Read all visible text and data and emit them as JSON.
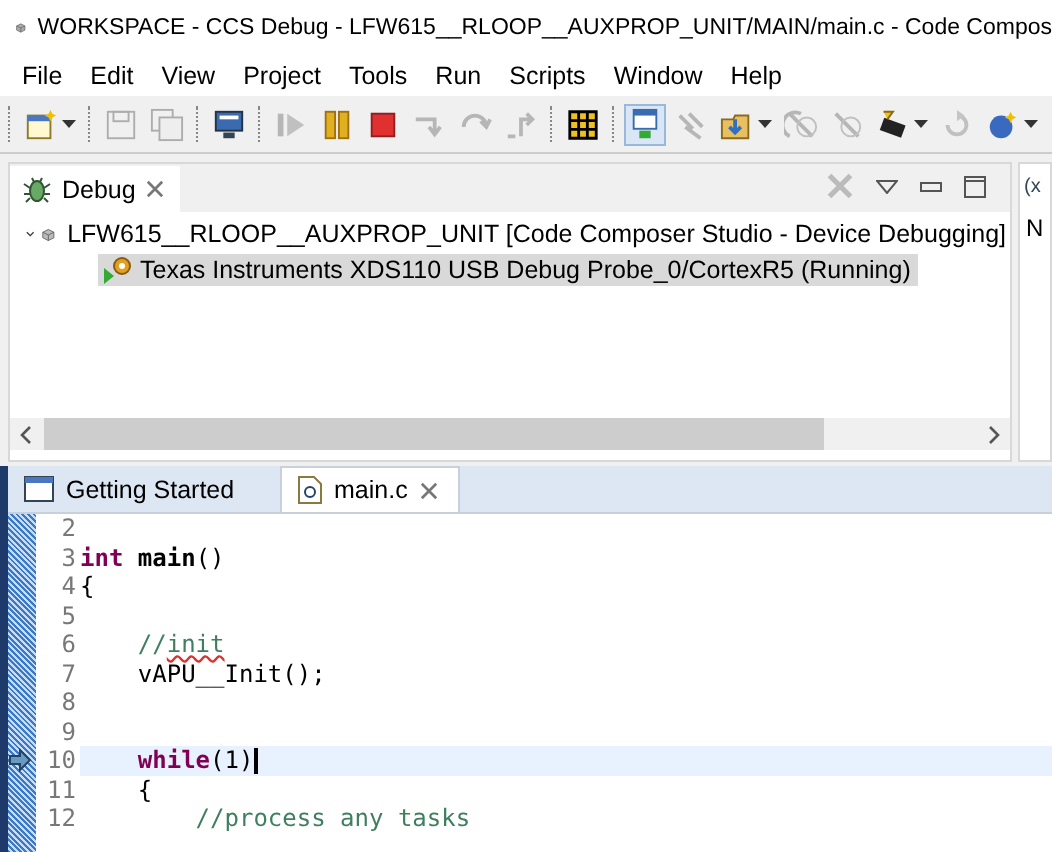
{
  "window": {
    "title": "WORKSPACE - CCS Debug - LFW615__RLOOP__AUXPROP_UNIT/MAIN/main.c - Code Compos"
  },
  "menu": [
    "File",
    "Edit",
    "View",
    "Project",
    "Tools",
    "Run",
    "Scripts",
    "Window",
    "Help"
  ],
  "toolbar": [
    [
      {
        "kind": "new",
        "disabled": false,
        "dropdown": true
      }
    ],
    [
      {
        "kind": "save",
        "disabled": true,
        "dropdown": false
      },
      {
        "kind": "save-all",
        "disabled": true,
        "dropdown": false
      }
    ],
    [
      {
        "kind": "monitor",
        "disabled": false,
        "dropdown": false
      }
    ],
    [
      {
        "kind": "resume",
        "disabled": true,
        "dropdown": false
      },
      {
        "kind": "pause",
        "disabled": false,
        "dropdown": false
      },
      {
        "kind": "stop",
        "disabled": false,
        "dropdown": false
      },
      {
        "kind": "step-into",
        "disabled": true,
        "dropdown": false
      },
      {
        "kind": "step-over",
        "disabled": true,
        "dropdown": false
      },
      {
        "kind": "step-return",
        "disabled": true,
        "dropdown": false
      }
    ],
    [
      {
        "kind": "grid",
        "disabled": false,
        "dropdown": false
      }
    ],
    [
      {
        "kind": "debug-view",
        "disabled": false,
        "dropdown": false,
        "selected": true
      },
      {
        "kind": "plug",
        "disabled": true,
        "dropdown": false
      },
      {
        "kind": "load",
        "disabled": false,
        "dropdown": true
      },
      {
        "kind": "reset",
        "disabled": true,
        "dropdown": false
      },
      {
        "kind": "restart",
        "disabled": true,
        "dropdown": false
      },
      {
        "kind": "chip",
        "disabled": false,
        "dropdown": true
      },
      {
        "kind": "refresh",
        "disabled": true,
        "dropdown": false
      },
      {
        "kind": "ball",
        "disabled": false,
        "dropdown": true
      }
    ]
  ],
  "debug_view": {
    "tab": "Debug",
    "tree": [
      {
        "label": "LFW615__RLOOP__AUXPROP_UNIT [Code Composer Studio - Device Debugging]",
        "expanded": true,
        "selected": false,
        "children": [
          {
            "label": "Texas Instruments XDS110 USB Debug Probe_0/CortexR5 (Running)",
            "selected": true
          }
        ]
      }
    ]
  },
  "side_panel": {
    "tab": "(x",
    "text": "N"
  },
  "editor": {
    "tabs": [
      {
        "label": "Getting Started",
        "kind": "page",
        "selected": false
      },
      {
        "label": "main.c",
        "kind": "file",
        "selected": true
      }
    ],
    "lines": [
      {
        "number": "2",
        "current": false
      },
      {
        "number": "3",
        "current": false,
        "segments": [
          {
            "text": "int",
            "kind": "keyword"
          },
          {
            "text": " main",
            "kind": "function"
          },
          {
            "text": "()",
            "kind": "plain"
          }
        ]
      },
      {
        "number": "4",
        "current": false,
        "segments": [
          {
            "text": "{",
            "kind": "plain"
          }
        ]
      },
      {
        "number": "5",
        "current": false
      },
      {
        "number": "6",
        "current": false,
        "segments": [
          {
            "text": "    //",
            "kind": "comment",
            "squiggle": false
          },
          {
            "text": "init",
            "kind": "comment",
            "squiggle": true
          }
        ]
      },
      {
        "number": "7",
        "current": false,
        "segments": [
          {
            "text": "    vAPU__Init();",
            "kind": "plain"
          }
        ]
      },
      {
        "number": "8",
        "current": false
      },
      {
        "number": "9",
        "current": false
      },
      {
        "number": "10",
        "current": true,
        "segments": [
          {
            "text": "    while",
            "kind": "keyword"
          },
          {
            "text": "(1)",
            "kind": "plain"
          }
        ]
      },
      {
        "number": "11",
        "current": false,
        "segments": [
          {
            "text": "    {",
            "kind": "plain"
          }
        ]
      },
      {
        "number": "12",
        "current": false,
        "segments": [
          {
            "text": "        //process any tasks",
            "kind": "comment"
          }
        ]
      }
    ]
  }
}
